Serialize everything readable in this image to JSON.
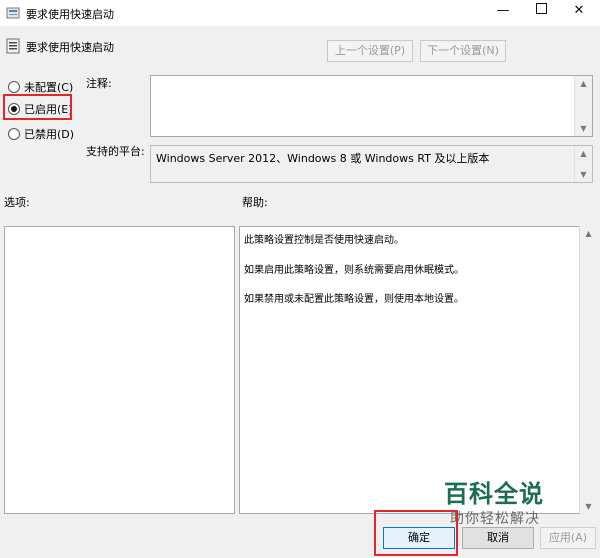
{
  "window": {
    "title": "要求使用快速启动",
    "controls": {
      "minimize": "—",
      "close": "✕"
    }
  },
  "header": {
    "policy_name": "要求使用快速启动",
    "prev_button": "上一个设置(P)",
    "next_button": "下一个设置(N)"
  },
  "state_options": [
    {
      "label": "未配置(C)",
      "selected": false
    },
    {
      "label": "已启用(E)",
      "selected": true
    },
    {
      "label": "已禁用(D)",
      "selected": false
    }
  ],
  "comment": {
    "label": "注释:",
    "value": ""
  },
  "platform": {
    "label": "支持的平台:",
    "value": "Windows Server 2012、Windows 8 或 Windows RT 及以上版本"
  },
  "options": {
    "label": "选项:"
  },
  "help": {
    "label": "帮助:",
    "lines": [
      "此策略设置控制是否使用快速启动。",
      "如果启用此策略设置，则系统需要启用休眠模式。",
      "如果禁用或未配置此策略设置，则使用本地设置。"
    ]
  },
  "buttons": {
    "ok": "确定",
    "cancel": "取消",
    "apply": "应用(A)"
  },
  "watermark": {
    "title": "百科全说",
    "subtitle": "助你轻松解决"
  },
  "colors": {
    "highlight": "#e0282a",
    "watermark": "#1d6e50",
    "window_bg": "#f0f0f0"
  }
}
